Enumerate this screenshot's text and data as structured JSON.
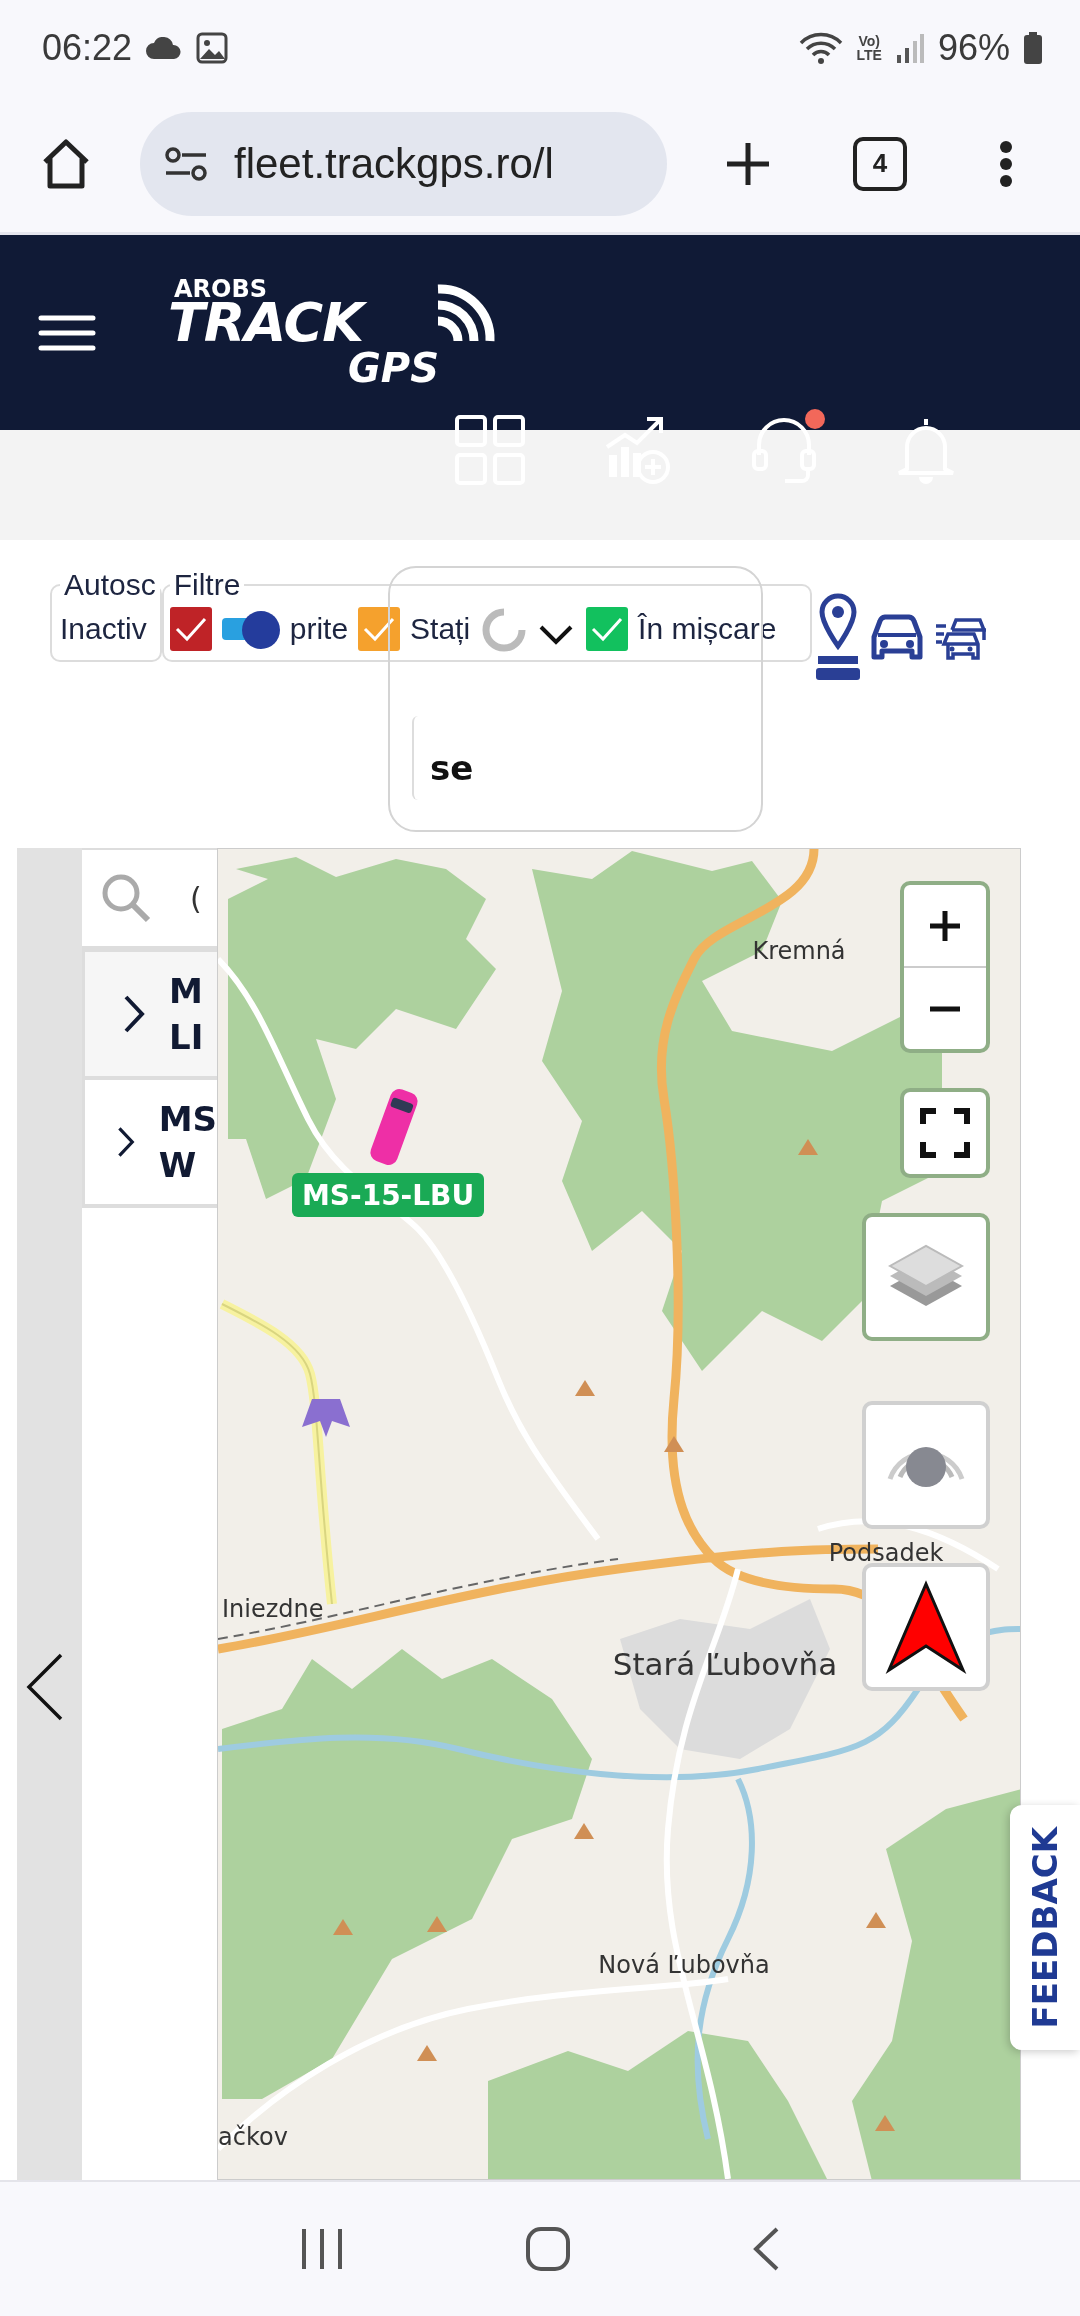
{
  "status_bar": {
    "time": "06:22",
    "volte_top": "Vo)",
    "volte_bottom": "LTE",
    "battery": "96%"
  },
  "browser": {
    "url": "fleet.trackgps.ro/l",
    "tab_count": "4"
  },
  "header": {
    "logo_top": "AROBS",
    "logo_main": "TRACK",
    "logo_sub": "GPS",
    "support_notification": true
  },
  "autoscroll": {
    "legend": "Autosc",
    "value": "Inactiv",
    "on": true
  },
  "filters": {
    "legend": "Filtre",
    "items": [
      {
        "label": "prite",
        "checked": true,
        "color": "#bf2327"
      },
      {
        "label": "Stați",
        "checked": true,
        "color": "#f5a12d"
      },
      {
        "label": "În mișcare",
        "checked": true,
        "color": "#12c15e"
      }
    ]
  },
  "dropdown": {
    "loading": true,
    "search_value": "se"
  },
  "vehicle_search": {
    "value": "("
  },
  "vehicles": [
    {
      "line1": "M",
      "line2": "LI",
      "selected": true
    },
    {
      "line1": "MS",
      "line2": "W",
      "selected": false
    }
  ],
  "map": {
    "labels": [
      "Kremná",
      "Iniezdne",
      "Stará Ľubovňa",
      "Podsadek",
      "Nová Ľubovňa",
      "ačkov"
    ],
    "vehicle_plate": "MS-15-LBU"
  },
  "feedback": "FEEDBACK"
}
